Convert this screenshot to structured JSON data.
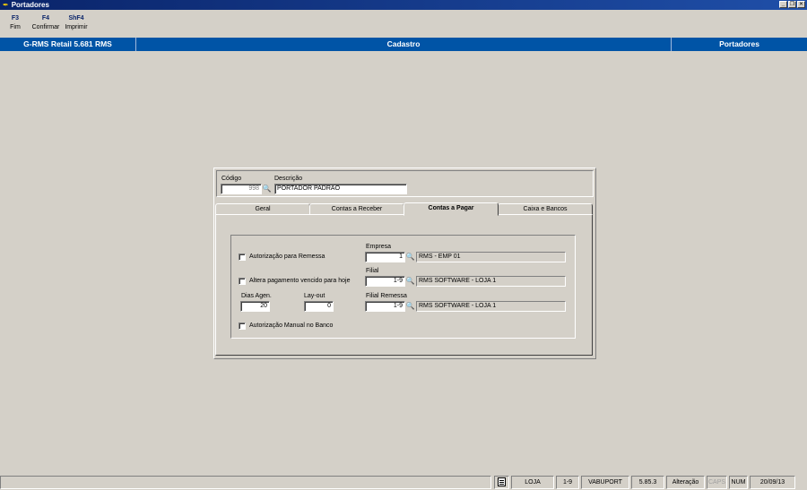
{
  "window": {
    "title": "Portadores"
  },
  "fkeys": [
    {
      "key": "F3",
      "label": "Fim"
    },
    {
      "key": "F4",
      "label": "Confirmar"
    },
    {
      "key": "ShF4",
      "label": "Imprimir"
    }
  ],
  "header": {
    "product": "G-RMS Retail 5.681 RMS",
    "section": "Cadastro",
    "module": "Portadores"
  },
  "form": {
    "codigo_label": "Código",
    "codigo_value": "998",
    "descricao_label": "Descrição",
    "descricao_value": "PORTADOR PADRAO"
  },
  "tabs": [
    {
      "label": "Geral"
    },
    {
      "label": "Contas a Receber"
    },
    {
      "label": "Contas a Pagar"
    },
    {
      "label": "Caixa e Bancos"
    }
  ],
  "pagar": {
    "autorizacao_remessa": "Autorização para Remessa",
    "altera_pagamento": "Altera pagamento vencido para hoje",
    "autorizacao_manual": "Autorização Manual no Banco",
    "dias_agen_label": "Dias Agen.",
    "dias_agen_value": "20",
    "layout_label": "Lay-out",
    "layout_value": "0",
    "empresa_label": "Empresa",
    "empresa_code": "1",
    "empresa_desc": "RMS - EMP 01",
    "filial_label": "Filial",
    "filial_code": "1-9",
    "filial_desc": "RMS SOFTWARE - LOJA 1",
    "filial_remessa_label": "Filial Remessa",
    "filial_remessa_code": "1-9",
    "filial_remessa_desc": "RMS SOFTWARE - LOJA 1"
  },
  "status": {
    "loja": "LOJA",
    "loja_code": "1-9",
    "program": "VABUPORT",
    "version": "5.85.3",
    "mode": "Alteração",
    "caps": "CAPS",
    "num": "NUM",
    "date": "20/09/13"
  },
  "icons": {
    "search": "binoculars-icon",
    "document": "document-icon"
  }
}
